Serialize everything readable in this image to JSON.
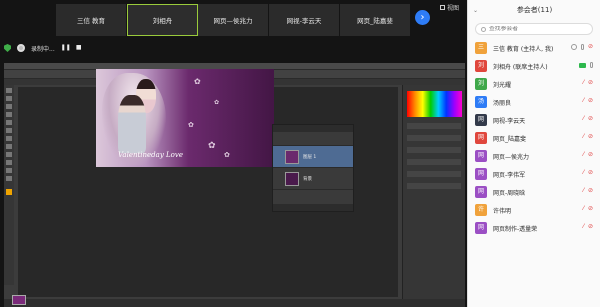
{
  "video_strip": {
    "tiles": [
      {
        "name": "三信 教育",
        "active": false
      },
      {
        "name": "刘相舟",
        "active": true
      },
      {
        "name": "网页—侯兆力",
        "active": false
      },
      {
        "name": "网视-李云天",
        "active": false
      },
      {
        "name": "网页_陆嘉斐",
        "active": false
      }
    ],
    "next_icon": "chevron-right-icon",
    "view_label": "视图"
  },
  "record_bar": {
    "status": "录制中...",
    "pause_glyph": "❚❚",
    "stop_glyph": "■"
  },
  "design": {
    "caption": "Valentineday Love",
    "flower_glyph": "✿"
  },
  "layers": {
    "rows": [
      {
        "name": "图层 1",
        "selected": true
      },
      {
        "name": "背景",
        "selected": false
      }
    ]
  },
  "participants": {
    "title": "参会者(11)",
    "collapse_icon": "chevron-down-icon",
    "search_placeholder": "查找参会者",
    "list": [
      {
        "avatar": "三",
        "color": "#f0a23b",
        "name": "三信 教育 (主持人, 我)",
        "share": true,
        "camera": false,
        "mic": true,
        "cam_on": false
      },
      {
        "avatar": "刘",
        "color": "#e0473d",
        "name": "刘相舟 (联席主持人)",
        "share": false,
        "camera": true,
        "mic": true,
        "cam_on": true
      },
      {
        "avatar": "刘",
        "color": "#3fa84a",
        "name": "刘光耀",
        "share": false,
        "camera": false,
        "mic": false,
        "cam_on": false
      },
      {
        "avatar": "汤",
        "color": "#2e7cf6",
        "name": "汤丽良",
        "share": false,
        "camera": false,
        "mic": false,
        "cam_on": false
      },
      {
        "avatar": "网",
        "color": "#333a4a",
        "name": "网视-李云天",
        "share": false,
        "camera": false,
        "mic": false,
        "cam_on": false
      },
      {
        "avatar": "网",
        "color": "#e0473d",
        "name": "网页_陆嘉斐",
        "share": false,
        "camera": false,
        "mic": false,
        "cam_on": false
      },
      {
        "avatar": "网",
        "color": "#9b4fc4",
        "name": "网页—侯兆力",
        "share": false,
        "camera": false,
        "mic": false,
        "cam_on": false
      },
      {
        "avatar": "网",
        "color": "#9b4fc4",
        "name": "网页-李伟军",
        "share": false,
        "camera": false,
        "mic": false,
        "cam_on": false
      },
      {
        "avatar": "网",
        "color": "#9b4fc4",
        "name": "网页-周晓晗",
        "share": false,
        "camera": false,
        "mic": false,
        "cam_on": false
      },
      {
        "avatar": "许",
        "color": "#f0a23b",
        "name": "许伟明",
        "share": false,
        "camera": false,
        "mic": false,
        "cam_on": false
      },
      {
        "avatar": "网",
        "color": "#9b4fc4",
        "name": "网页制作-透量荣",
        "share": false,
        "camera": false,
        "mic": false,
        "cam_on": false
      }
    ]
  }
}
